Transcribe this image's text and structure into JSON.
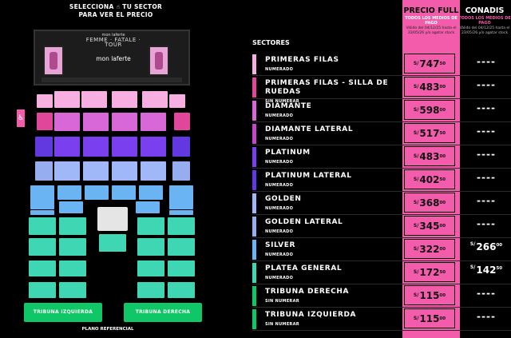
{
  "instruction": {
    "line1": "SELECCIONA",
    "hand": "☝",
    "line1b": "TU SECTOR",
    "line2": "PARA VER EL PRECIO"
  },
  "stage": {
    "top_line": "mon laferte",
    "tour": "FEMME · FATALE · TOUR",
    "logo": "mon laferte"
  },
  "map": {
    "accessibility_badge": "♿",
    "tribune_left": "TRIBUNA IZQUIERDA",
    "tribune_right": "TRIBUNA DERECHA",
    "plano": "PLANO REFERENCIAL",
    "colors": {
      "primeras": "#f7aee0",
      "silla": "#e0479a",
      "diamante": "#d868d8",
      "diamante_lateral": "#c248c8",
      "platinum": "#7a40f0",
      "platinum_lateral": "#6238e0",
      "golden": "#a0b8f8",
      "golden_lateral": "#96aef0",
      "silver": "#6ab4f4",
      "platea": "#3fd6b4",
      "tribuna": "#0fc767"
    }
  },
  "header": {
    "full": {
      "title": "PRECIO FULL",
      "subtitle": "TODOS LOS MEDIOS DE PAGO",
      "validity": "Válido del 04/12/25 hasta el 23/05/26 y/o agotar stock"
    },
    "conadis": {
      "title": "CONADIS",
      "subtitle": "TODOS LOS MEDIOS DE PAGO",
      "validity": "Válido del 04/12/25 hasta el 23/05/26 y/o agotar stock"
    }
  },
  "sectors_title": "SECTORES",
  "sectors": [
    {
      "name": "PRIMERAS FILAS",
      "sub": "NUMERADO",
      "price": "747",
      "cents": "50",
      "conadis": "----",
      "color": "#f7aee0"
    },
    {
      "name": "PRIMERAS FILAS - SILLA DE RUEDAS",
      "sub": "SIN NUMERAR",
      "price": "483",
      "cents": "00",
      "conadis": "----",
      "color": "#e0479a"
    },
    {
      "name": "DIAMANTE",
      "sub": "NUMERADO",
      "price": "598",
      "cents": "00",
      "conadis": "----",
      "color": "#d868d8"
    },
    {
      "name": "DIAMANTE LATERAL",
      "sub": "NUMERADO",
      "price": "517",
      "cents": "50",
      "conadis": "----",
      "color": "#c248c8"
    },
    {
      "name": "PLATINUM",
      "sub": "NUMERADO",
      "price": "483",
      "cents": "00",
      "conadis": "----",
      "color": "#7a40f0"
    },
    {
      "name": "PLATINUM LATERAL",
      "sub": "NUMERADO",
      "price": "402",
      "cents": "50",
      "conadis": "----",
      "color": "#6238e0"
    },
    {
      "name": "GOLDEN",
      "sub": "NUMERADO",
      "price": "368",
      "cents": "00",
      "conadis": "----",
      "color": "#a0b8f8"
    },
    {
      "name": "GOLDEN LATERAL",
      "sub": "NUMERADO",
      "price": "345",
      "cents": "00",
      "conadis": "----",
      "color": "#96aef0"
    },
    {
      "name": "SILVER",
      "sub": "NUMERADO",
      "price": "322",
      "cents": "00",
      "conadis": "266",
      "conadis_cents": "00",
      "color": "#6ab4f4"
    },
    {
      "name": "PLATEA GENERAL",
      "sub": "NUMERADO",
      "price": "172",
      "cents": "50",
      "conadis": "142",
      "conadis_cents": "50",
      "color": "#3fd6b4"
    },
    {
      "name": "TRIBUNA DERECHA",
      "sub": "SIN NUMERAR",
      "price": "115",
      "cents": "00",
      "conadis": "----",
      "color": "#0fc767"
    },
    {
      "name": "TRIBUNA IZQUIERDA",
      "sub": "SIN NUMERAR",
      "price": "115",
      "cents": "00",
      "conadis": "----",
      "color": "#0fc767"
    }
  ],
  "currency": "S/"
}
